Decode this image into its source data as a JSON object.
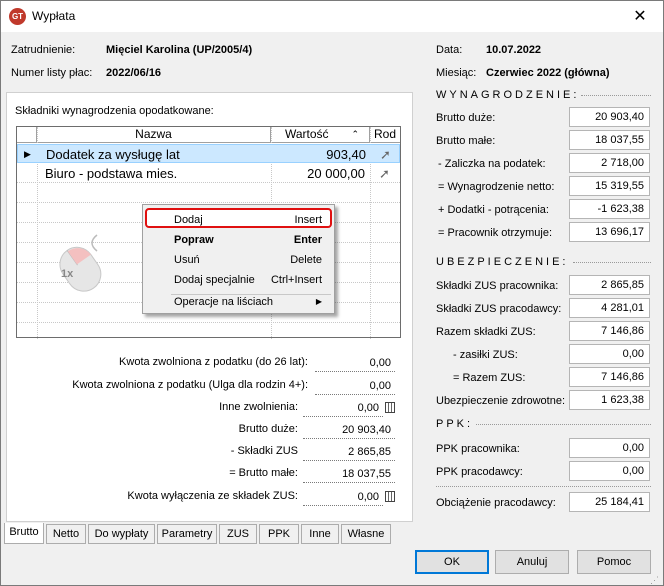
{
  "window": {
    "title": "Wypłata",
    "close": "✕"
  },
  "header": {
    "employment_label": "Zatrudnienie:",
    "employment_value": "Mięciel Karolina (UP/2005/4)",
    "payroll_label": "Numer listy płac:",
    "payroll_value": "2022/06/16",
    "date_label": "Data:",
    "date_value": "10.07.2022",
    "month_label": "Miesiąc:",
    "month_value": "Czerwiec 2022 (główna)"
  },
  "components": {
    "title": "Składniki wynagrodzenia opodatkowane:",
    "columns": [
      "Nazwa",
      "Wartość",
      "Rod"
    ],
    "rows": [
      {
        "name": "Dodatek za wysługę lat",
        "value": "903,40"
      },
      {
        "name": "Biuro - podstawa mies.",
        "value": "20 000,00"
      }
    ]
  },
  "context_menu": [
    {
      "label": "Dodaj",
      "shortcut": "Insert"
    },
    {
      "label": "Popraw",
      "shortcut": "Enter"
    },
    {
      "label": "Usuń",
      "shortcut": "Delete"
    },
    {
      "label": "Dodaj specjalnie",
      "shortcut": "Ctrl+Insert"
    },
    {
      "label": "Operacje na liściach",
      "shortcut": "▶"
    }
  ],
  "cursor_badge": "1x",
  "summary": [
    {
      "label": "Kwota zwolniona z podatku (do 26 lat):",
      "value": "0,00"
    },
    {
      "label": "Kwota zwolniona z podatku (Ulga dla rodzin 4+):",
      "value": "0,00"
    },
    {
      "label": "Inne zwolnienia:",
      "value": "0,00"
    },
    {
      "label": "Brutto duże:",
      "value": "20 903,40"
    },
    {
      "label": "- Składki ZUS",
      "value": "2 865,85"
    },
    {
      "label": "= Brutto małe:",
      "value": "18 037,55"
    },
    {
      "label": "Kwota wyłączenia ze składek ZUS:",
      "value": "0,00"
    }
  ],
  "wynagrodzenie": {
    "title": "WYNAGRODZENIE:",
    "rows": [
      {
        "label": "Brutto duże:",
        "value": "20 903,40"
      },
      {
        "label": "Brutto małe:",
        "value": "18 037,55"
      },
      {
        "label": "- Zaliczka na podatek:",
        "value": "2 718,00"
      },
      {
        "label": "= Wynagrodzenie netto:",
        "value": "15 319,55"
      },
      {
        "label": "+ Dodatki - potrącenia:",
        "value": "-1 623,38"
      },
      {
        "label": "= Pracownik otrzymuje:",
        "value": "13 696,17"
      }
    ]
  },
  "ubezpieczenie": {
    "title": "UBEZPIECZENIE:",
    "rows": [
      {
        "label": "Składki ZUS pracownika:",
        "value": "2 865,85"
      },
      {
        "label": "Składki ZUS pracodawcy:",
        "value": "4 281,01"
      },
      {
        "label": "Razem składki ZUS:",
        "value": "7 146,86"
      },
      {
        "label": "- zasiłki ZUS:",
        "value": "0,00"
      },
      {
        "label": "= Razem ZUS:",
        "value": "7 146,86"
      },
      {
        "label": "Ubezpieczenie zdrowotne:",
        "value": "1 623,38"
      }
    ]
  },
  "ppk": {
    "title": "PPK:",
    "rows": [
      {
        "label": "PPK pracownika:",
        "value": "0,00"
      },
      {
        "label": "PPK pracodawcy:",
        "value": "0,00"
      }
    ]
  },
  "employer_cost": {
    "label": "Obciążenie pracodawcy:",
    "value": "25 184,41"
  },
  "tabs": [
    "Brutto",
    "Netto",
    "Do wypłaty",
    "Parametry",
    "ZUS",
    "PPK",
    "Inne",
    "Własne"
  ],
  "buttons": {
    "ok": "OK",
    "cancel": "Anuluj",
    "help": "Pomoc"
  },
  "colors": {
    "selected_row": "#cce8ff",
    "highlight_border": "#e01010",
    "focus": "#0078d7"
  }
}
